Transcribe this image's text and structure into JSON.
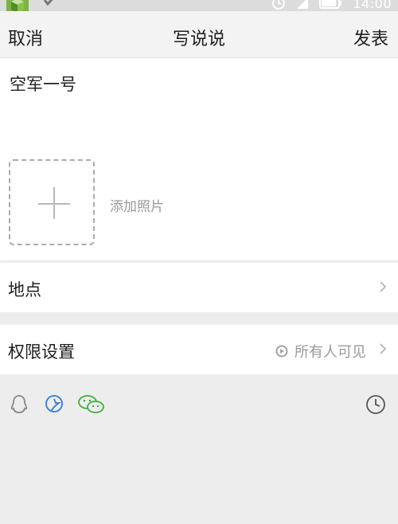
{
  "status_bar": {
    "time": "14:00",
    "icons": [
      "android-icon",
      "check-icon",
      "alarm-icon",
      "signal-icon",
      "battery-icon"
    ]
  },
  "header": {
    "cancel_label": "取消",
    "title": "写说说",
    "publish_label": "发表"
  },
  "compose": {
    "text": "空军一号",
    "add_photo_label": "添加照片"
  },
  "location": {
    "label": "地点"
  },
  "permission": {
    "label": "权限设置",
    "value": "所有人可见"
  },
  "share": {
    "icons": [
      "qq-icon",
      "qzone-icon",
      "wechat-icon"
    ],
    "schedule_icon": "clock-icon"
  },
  "colors": {
    "background": "#ededee",
    "wechat_green": "#3cb034",
    "qzone_blue": "#3f86d6",
    "muted_text": "#9a9a9a"
  }
}
